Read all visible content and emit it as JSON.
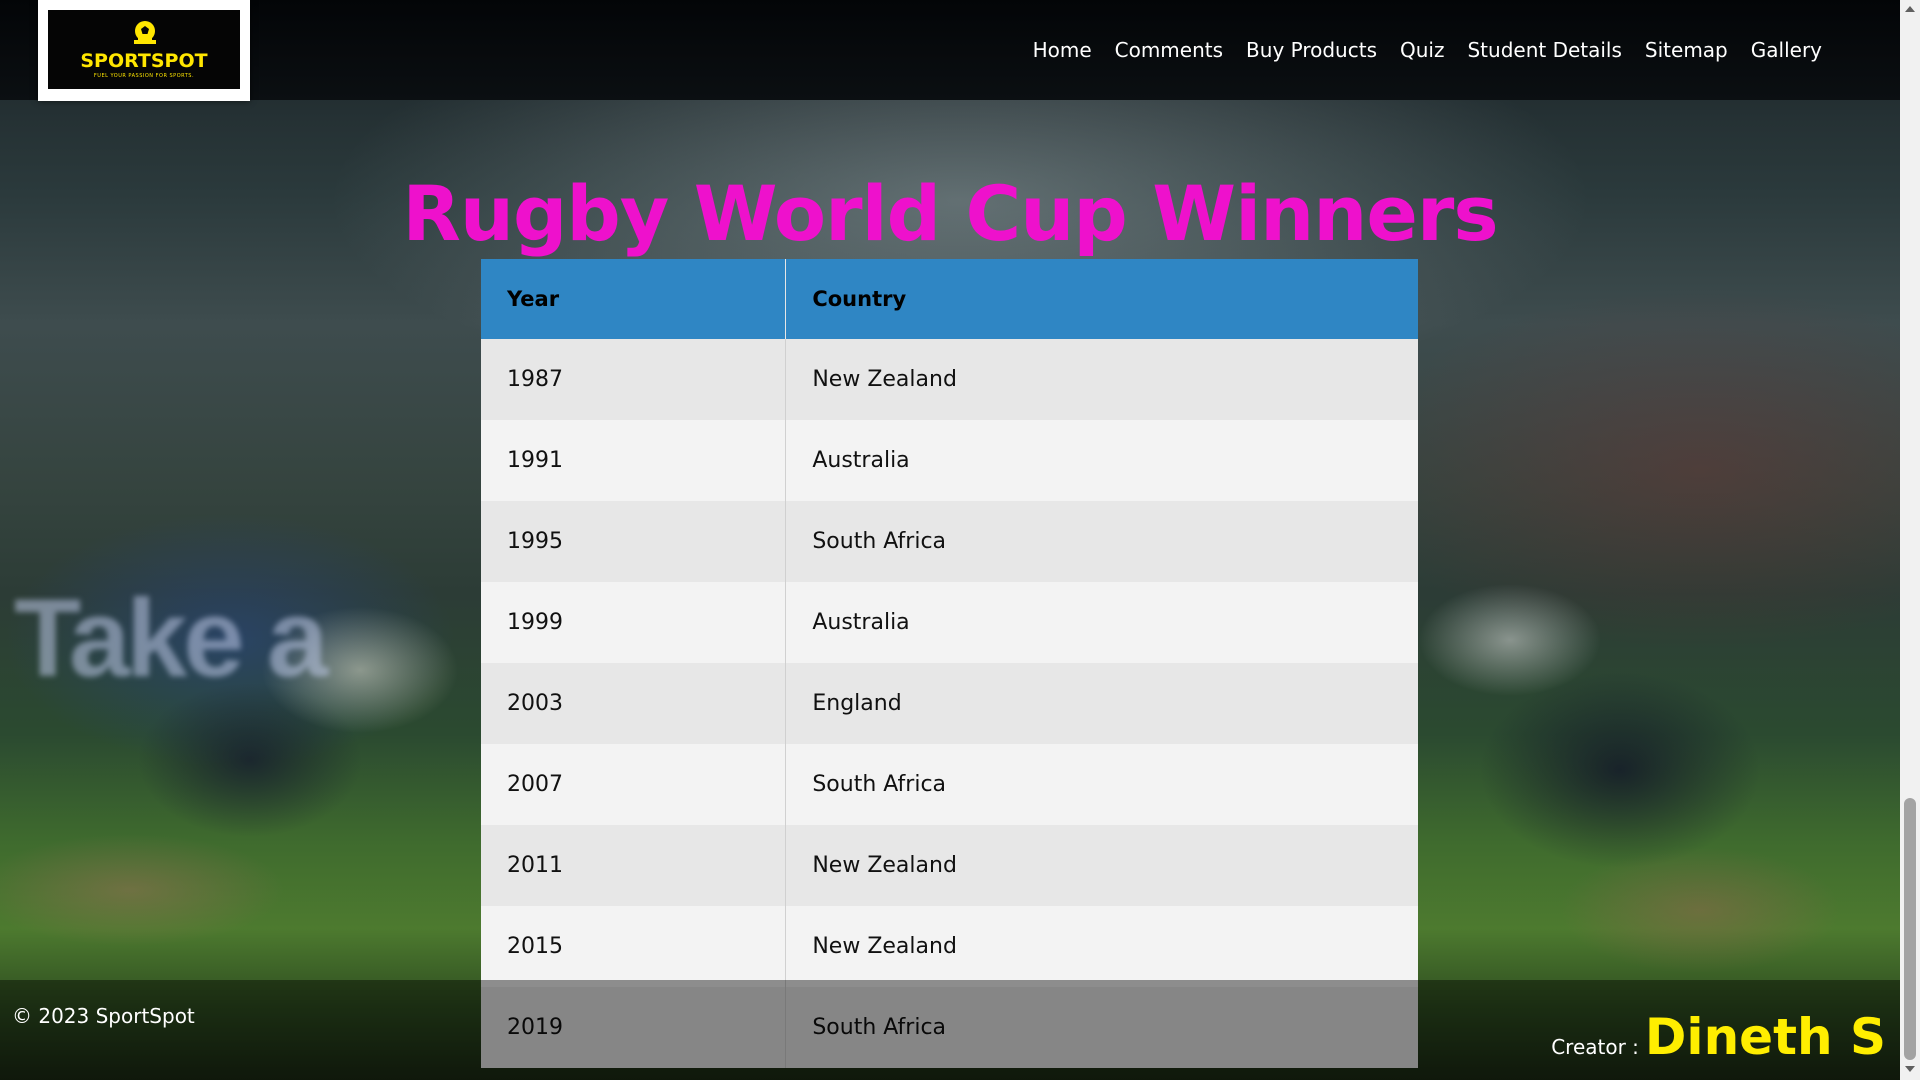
{
  "logo": {
    "brand": "SPORTSPOT",
    "tagline": "FUEL YOUR PASSION FOR SPORTS.",
    "icon": "soccer-ball-icon",
    "brand_color": "#ffe600"
  },
  "nav": {
    "items": [
      {
        "label": "Home"
      },
      {
        "label": "Comments"
      },
      {
        "label": "Buy Products"
      },
      {
        "label": "Quiz"
      },
      {
        "label": "Student Details"
      },
      {
        "label": "Sitemap"
      },
      {
        "label": "Gallery"
      }
    ]
  },
  "page": {
    "title": "Rugby World Cup Winners",
    "title_color": "#ee11cc"
  },
  "table": {
    "header_color": "#2f86c4",
    "columns": [
      "Year",
      "Country"
    ],
    "rows": [
      [
        "1987",
        "New Zealand"
      ],
      [
        "1991",
        "Australia"
      ],
      [
        "1995",
        "South Africa"
      ],
      [
        "1999",
        "Australia"
      ],
      [
        "2003",
        "England"
      ],
      [
        "2007",
        "South Africa"
      ],
      [
        "2011",
        "New Zealand"
      ],
      [
        "2015",
        "New Zealand"
      ],
      [
        "2019",
        "South Africa"
      ]
    ]
  },
  "footer": {
    "copyright": "© 2023 SportSpot",
    "creator_label": "Creator :",
    "creator_name": "Dineth S",
    "creator_color": "#ffee00"
  },
  "background": {
    "banner_text": "Take a"
  }
}
